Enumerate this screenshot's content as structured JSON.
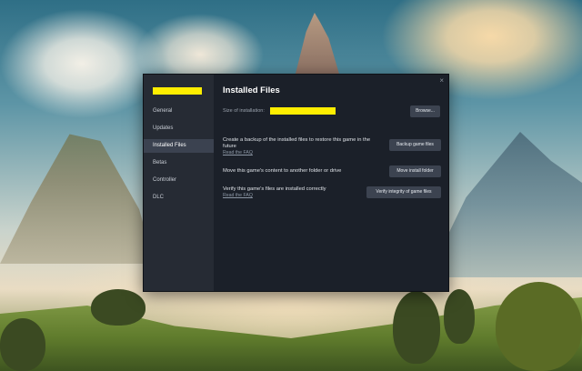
{
  "window": {
    "close_glyph": "×"
  },
  "sidebar": {
    "items": [
      {
        "label": "General",
        "active": false
      },
      {
        "label": "Updates",
        "active": false
      },
      {
        "label": "Installed Files",
        "active": true
      },
      {
        "label": "Betas",
        "active": false
      },
      {
        "label": "Controller",
        "active": false
      },
      {
        "label": "DLC",
        "active": false
      }
    ]
  },
  "main": {
    "title": "Installed Files",
    "size_label": "Size of installation:",
    "browse_label": "Browse...",
    "backup": {
      "text": "Create a backup of the installed files to restore this game in the future",
      "link": "Read the FAQ",
      "button": "Backup game files"
    },
    "move": {
      "text": "Move this game's content to another folder or drive",
      "button": "Move install folder"
    },
    "verify": {
      "text": "Verify this game's files are installed correctly",
      "link": "Read the FAQ",
      "button": "Verify integrity of game files"
    }
  },
  "colors": {
    "redaction": "#ffee00",
    "window_bg": "#1b2029",
    "sidebar_bg": "#262b34",
    "button_bg": "#3c4350"
  }
}
